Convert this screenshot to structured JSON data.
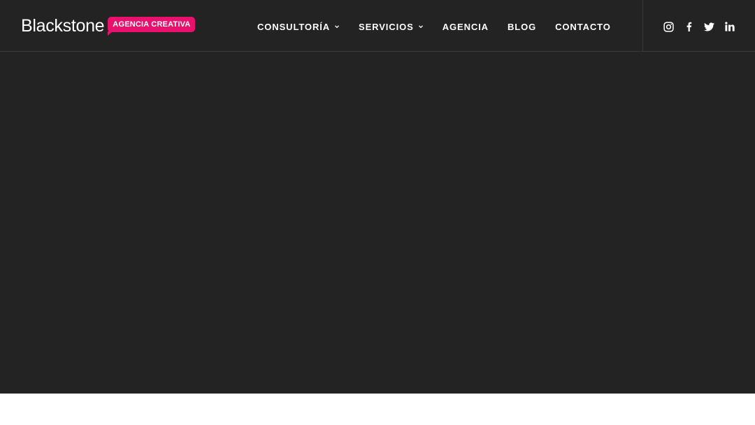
{
  "header": {
    "logo": {
      "name": "Blackstone",
      "badge": "AGENCIA CREATIVA"
    },
    "nav": [
      {
        "label": "CONSULTORÍA",
        "has_dropdown": true
      },
      {
        "label": "SERVICIOS",
        "has_dropdown": true
      },
      {
        "label": "AGENCIA",
        "has_dropdown": false
      },
      {
        "label": "BLOG",
        "has_dropdown": false
      },
      {
        "label": "CONTACTO",
        "has_dropdown": false
      }
    ],
    "social": [
      "instagram-icon",
      "facebook-icon",
      "twitter-icon",
      "linkedin-icon"
    ]
  },
  "colors": {
    "hero_background": "#232323",
    "brand_accent": "#e8116e",
    "text": "#ffffff",
    "divider": "#3a3a3a"
  }
}
